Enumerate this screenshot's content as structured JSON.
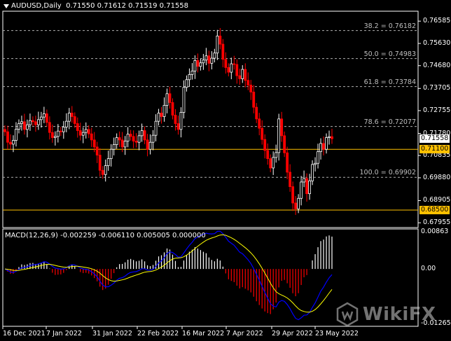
{
  "header": {
    "symbol_timeframe": "AUDUSD,Daily",
    "ohlc": "0.71550 0.71612 0.71519 0.71558"
  },
  "macd_header": "MACD(12,26,9) -0.002259 -0.006110 0.005005 0.000000",
  "price_axis": [
    "0.76585",
    "0.75630",
    "0.74680",
    "0.73705",
    "0.72755",
    "0.71780",
    "0.70835",
    "0.69880",
    "0.68905",
    "0.67955"
  ],
  "macd_axis": [
    "0.00863",
    "0.00",
    "-0.012657"
  ],
  "current_price": {
    "label": "0.71558",
    "value": 0.71558
  },
  "h_levels": [
    {
      "label": "0.71100",
      "value": 0.711
    },
    {
      "label": "0.68500",
      "value": 0.685
    }
  ],
  "fib_levels": [
    {
      "label": "38.2 = 0.76182",
      "value": 0.76182
    },
    {
      "label": "50.0 = 0.74983",
      "value": 0.74983
    },
    {
      "label": "61.8 = 0.73784",
      "value": 0.73784
    },
    {
      "label": "78.6 = 0.72077",
      "value": 0.72077
    },
    {
      "label": "100.0 = 0.69902",
      "value": 0.69902
    }
  ],
  "dates": [
    "16 Dec 2021",
    "7 Jan 2022",
    "31 Jan 2022",
    "22 Feb 2022",
    "16 Mar 2022",
    "7 Apr 2022",
    "29 Apr 2022",
    "23 May 2022"
  ],
  "watermark": "WikiFX",
  "colors": {
    "bull": "#ffffff",
    "bear": "#ff0000",
    "level": "#ffc000",
    "macd": "#0000ff",
    "signal": "#ffff00",
    "hist_pos": "#ffffff",
    "hist_neg": "#ff0000",
    "grid": "#888888"
  },
  "chart_data": {
    "type": "candlestick",
    "symbol": "AUDUSD",
    "timeframe": "Daily",
    "ylim": [
      0.6775,
      0.7695
    ],
    "closes": [
      0.7185,
      0.714,
      0.7132,
      0.7148,
      0.7196,
      0.722,
      0.7228,
      0.7195,
      0.7215,
      0.7233,
      0.7228,
      0.7215,
      0.7237,
      0.7248,
      0.7262,
      0.7225,
      0.7182,
      0.716,
      0.7165,
      0.7188,
      0.7185,
      0.7205,
      0.723,
      0.7265,
      0.725,
      0.722,
      0.719,
      0.717,
      0.7182,
      0.7195,
      0.7176,
      0.715,
      0.712,
      0.7085,
      0.702,
      0.7002,
      0.704,
      0.707,
      0.711,
      0.713,
      0.716,
      0.715,
      0.712,
      0.7145,
      0.7175,
      0.7165,
      0.7145,
      0.714,
      0.7168,
      0.719,
      0.715,
      0.711,
      0.714,
      0.717,
      0.723,
      0.7265,
      0.725,
      0.7298,
      0.7348,
      0.731,
      0.7256,
      0.722,
      0.7195,
      0.7268,
      0.7375,
      0.7408,
      0.743,
      0.7445,
      0.749,
      0.7465,
      0.748,
      0.7492,
      0.751,
      0.7478,
      0.75,
      0.7522,
      0.7595,
      0.756,
      0.7495,
      0.746,
      0.744,
      0.7476,
      0.7473,
      0.7425,
      0.7412,
      0.7452,
      0.7405,
      0.7385,
      0.7355,
      0.729,
      0.724,
      0.72,
      0.7152,
      0.7105,
      0.707,
      0.703,
      0.7075,
      0.7096,
      0.724,
      0.7168,
      0.7095,
      0.7012,
      0.695,
      0.688,
      0.6855,
      0.69,
      0.697,
      0.6985,
      0.692,
      0.6975,
      0.7045,
      0.705,
      0.71,
      0.7135,
      0.711,
      0.716,
      0.7164,
      0.7155
    ]
  }
}
